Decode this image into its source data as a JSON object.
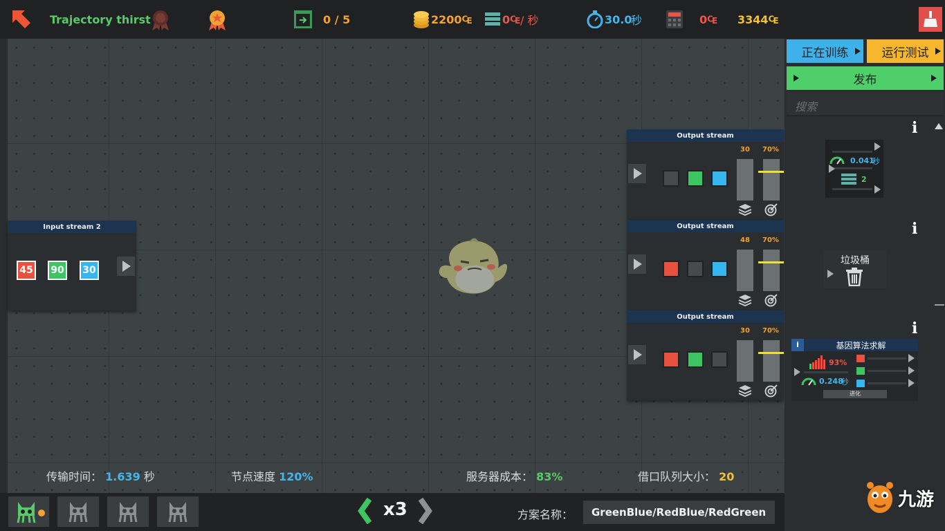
{
  "topbar": {
    "player_name": "Trajectory thirst",
    "level_progress": "0 / 5",
    "coins": "2200₠",
    "rate_value": "0₠",
    "rate_unit": "/ 秒",
    "timer_value": "30.0",
    "timer_unit": "秒",
    "cost": "0₠",
    "total": "3344₠"
  },
  "input_node": {
    "title": "Input stream 2",
    "values": [
      "45",
      "90",
      "30"
    ]
  },
  "output_nodes": [
    {
      "title": "Output stream",
      "count": "30",
      "percent": "70%",
      "squares": [
        "dark",
        "green",
        "blue"
      ],
      "fill": 0.7
    },
    {
      "title": "Output stream",
      "count": "48",
      "percent": "70%",
      "squares": [
        "red",
        "dark",
        "blue"
      ],
      "fill": 0.7
    },
    {
      "title": "Output stream",
      "count": "30",
      "percent": "70%",
      "squares": [
        "red",
        "green",
        "dark"
      ],
      "fill": 0.7
    }
  ],
  "stats": {
    "transfer_label": "传输时间：",
    "transfer_value": "1.639",
    "transfer_unit": "秒",
    "node_speed_label": "节点速度",
    "node_speed_value": "120%",
    "server_cost_label": "服务器成本：",
    "server_cost_value": "83%",
    "queue_label": "借口队列大小：",
    "queue_value": "20"
  },
  "bottom": {
    "multiplier": "x3",
    "plan_label": "方案名称：",
    "plan_value": "GreenBlue/RedBlue/RedGreen"
  },
  "right_panel": {
    "training_button": "正在训练",
    "test_button": "运行测试",
    "publish_button": "发布",
    "search_placeholder": "搜索",
    "speed_widget": {
      "time_value": "0.041",
      "time_unit": "秒",
      "queue_value": "2"
    },
    "trash_widget": {
      "label": "垃圾桶"
    },
    "genetic_widget": {
      "title": "基因算法求解",
      "info": "i",
      "percent": "93%",
      "time_value": "0.248",
      "time_unit": "秒",
      "evolve_button": "进化"
    }
  },
  "watermark": "九游",
  "colors": {
    "accent_green": "#59c96b",
    "accent_orange": "#f2a233",
    "accent_blue": "#45b6ea",
    "accent_red": "#e9574a",
    "node_header": "#1d3450"
  }
}
